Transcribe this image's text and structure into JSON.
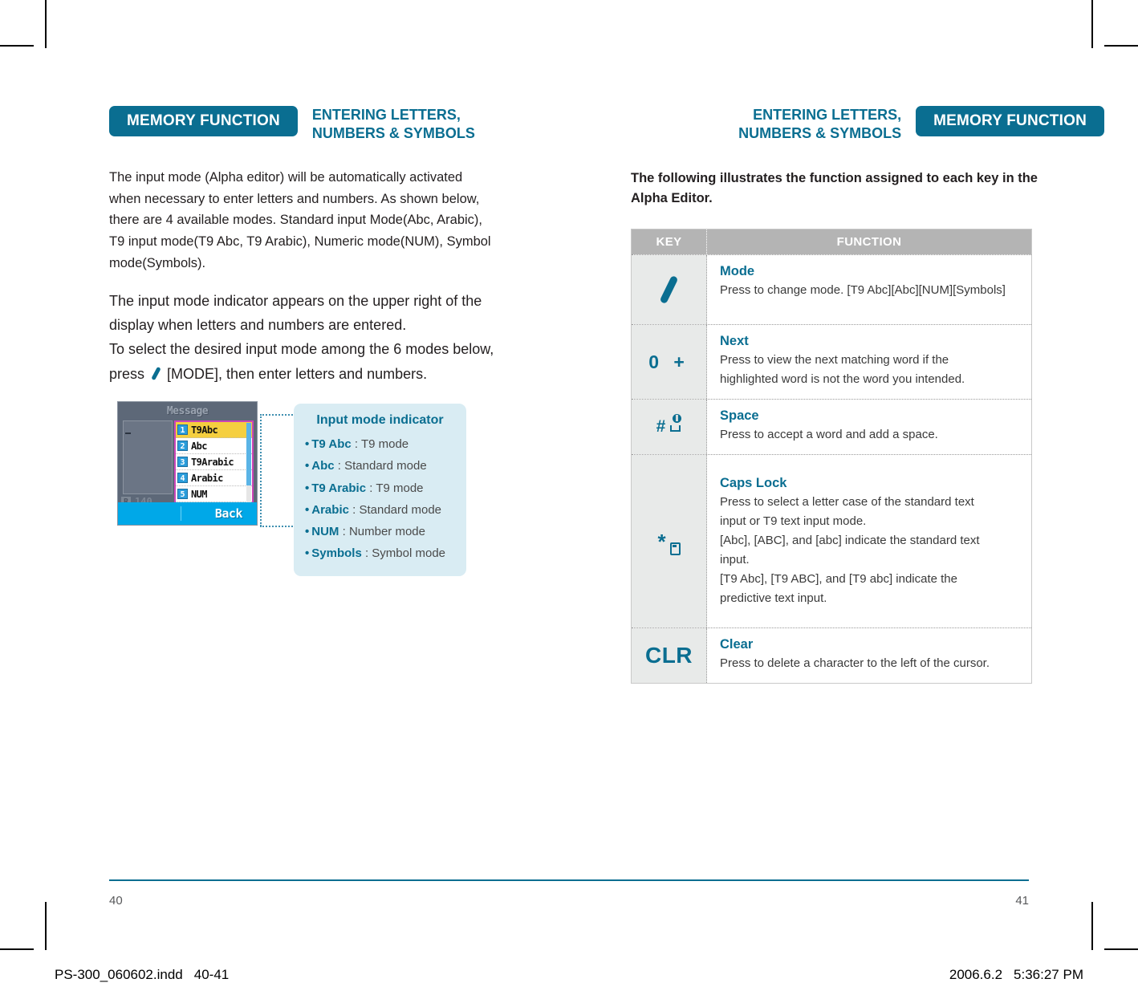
{
  "document": {
    "type": "printed-manual-spread",
    "brand_color": "#0a6e91",
    "callout_bg": "#d9ecf3"
  },
  "left_page": {
    "badge": "MEMORY FUNCTION",
    "section_title_line1": "ENTERING LETTERS,",
    "section_title_line2": "NUMBERS & SYMBOLS",
    "intro_lines": [
      "The input mode (Alpha editor) will be automatically activated",
      "when necessary to enter letters and numbers. As shown below,",
      "there are 4 available modes. Standard input Mode(Abc, Arabic),",
      "T9 input mode(T9 Abc, T9 Arabic), Numeric mode(NUM), Symbol",
      "mode(Symbols)."
    ],
    "para2_lines": [
      "The input mode indicator appears on the upper right  of the",
      "display when letters and numbers are entered.",
      "To select the desired input mode among the 6 modes below,"
    ],
    "para2_last_prefix": "press",
    "para2_last_suffix": "[MODE], then enter letters and numbers.",
    "folio": "40"
  },
  "phone_screen": {
    "title": "Message",
    "status_roam": "R",
    "status_count": "140",
    "softkey_right": "Back",
    "menu_items": [
      {
        "num": "1",
        "label": "T9Abc",
        "selected": true
      },
      {
        "num": "2",
        "label": "Abc",
        "selected": false
      },
      {
        "num": "3",
        "label": "T9Arabic",
        "selected": false
      },
      {
        "num": "4",
        "label": "Arabic",
        "selected": false
      },
      {
        "num": "5",
        "label": "NUM",
        "selected": false
      }
    ]
  },
  "callout": {
    "title": "Input mode indicator",
    "items": [
      {
        "term": "T9 Abc",
        "desc": ": T9 mode"
      },
      {
        "term": "Abc",
        "desc": ": Standard mode"
      },
      {
        "term": "T9 Arabic",
        "desc": ": T9 mode"
      },
      {
        "term": "Arabic",
        "desc": ": Standard mode"
      },
      {
        "term": "NUM",
        "desc": ": Number mode"
      },
      {
        "term": "Symbols",
        "desc": ": Symbol mode"
      }
    ]
  },
  "right_page": {
    "badge": "MEMORY FUNCTION",
    "section_title_line1": "ENTERING LETTERS,",
    "section_title_line2": "NUMBERS & SYMBOLS",
    "intro_lines": [
      "The following illustrates the function assigned to each key in the",
      "Alpha Editor."
    ],
    "folio": "41"
  },
  "key_table": {
    "header": {
      "key": "KEY",
      "function": "FUNCTION"
    },
    "rows": [
      {
        "key_glyph": "soft-key-slash-icon",
        "key_label": "",
        "title": "Mode",
        "desc_lines": [
          "Press to change mode. [T9 Abc][Abc][NUM][Symbols]"
        ]
      },
      {
        "key_glyph": "zero-plus-key",
        "key_label": "0 +",
        "title": "Next",
        "desc_lines": [
          "Press to view the next matching word if the",
          "highlighted word is not the word you intended."
        ]
      },
      {
        "key_glyph": "hash-space-lock-key",
        "key_label": "#",
        "title": "Space",
        "desc_lines": [
          "Press to accept a word and add a space."
        ]
      },
      {
        "key_glyph": "star-silent-key",
        "key_label": "*",
        "title": "Caps Lock",
        "desc_lines": [
          "Press to select a letter case of the standard text",
          "input or T9 text input mode.",
          "[Abc], [ABC], and [abc] indicate the standard text",
          "input.",
          "[T9 Abc], [T9 ABC], and [T9 abc] indicate the",
          "predictive text input."
        ]
      },
      {
        "key_glyph": "clr-key",
        "key_label": "CLR",
        "title": "Clear",
        "desc_lines": [
          "Press to delete a character to the left of the cursor."
        ]
      }
    ]
  },
  "print_slug": {
    "filename": "PS-300_060602.indd",
    "pages": "40-41",
    "date": "2006.6.2",
    "time": "5:36:27 PM"
  }
}
